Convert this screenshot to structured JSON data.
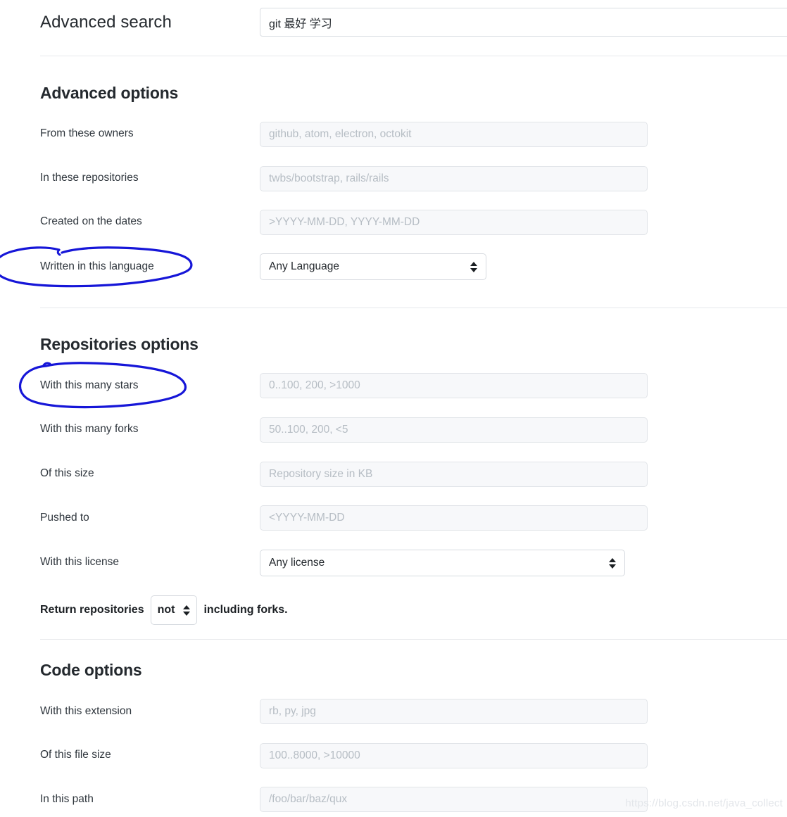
{
  "search": {
    "title": "Advanced search",
    "value": "git 最好 学习"
  },
  "sections": {
    "advanced": {
      "title": "Advanced options",
      "fields": [
        {
          "label": "From these owners",
          "placeholder": "github, atom, electron, octokit"
        },
        {
          "label": "In these repositories",
          "placeholder": "twbs/bootstrap, rails/rails"
        },
        {
          "label": "Created on the dates",
          "placeholder": ">YYYY-MM-DD, YYYY-MM-DD"
        },
        {
          "label": "Written in this language",
          "selected": "Any Language"
        }
      ]
    },
    "repositories": {
      "title": "Repositories options",
      "fields": [
        {
          "label": "With this many stars",
          "placeholder": "0..100, 200, >1000"
        },
        {
          "label": "With this many forks",
          "placeholder": "50..100, 200, <5"
        },
        {
          "label": "Of this size",
          "placeholder": "Repository size in KB"
        },
        {
          "label": "Pushed to",
          "placeholder": "<YYYY-MM-DD"
        },
        {
          "label": "With this license",
          "selected": "Any license"
        }
      ],
      "forks_line": {
        "prefix": "Return repositories",
        "selected": "not",
        "suffix": "including forks."
      }
    },
    "code": {
      "title": "Code options",
      "fields": [
        {
          "label": "With this extension",
          "placeholder": "rb, py, jpg"
        },
        {
          "label": "Of this file size",
          "placeholder": "100..8000, >10000"
        },
        {
          "label": "In this path",
          "placeholder": "/foo/bar/baz/qux"
        }
      ]
    }
  },
  "annotations": {
    "color": "#1616d8",
    "items": [
      {
        "name": "language-label-circle",
        "target": "Written in this language"
      },
      {
        "name": "stars-label-circle",
        "target": "With this many stars"
      }
    ]
  },
  "watermark": "https://blog.csdn.net/java_collect"
}
